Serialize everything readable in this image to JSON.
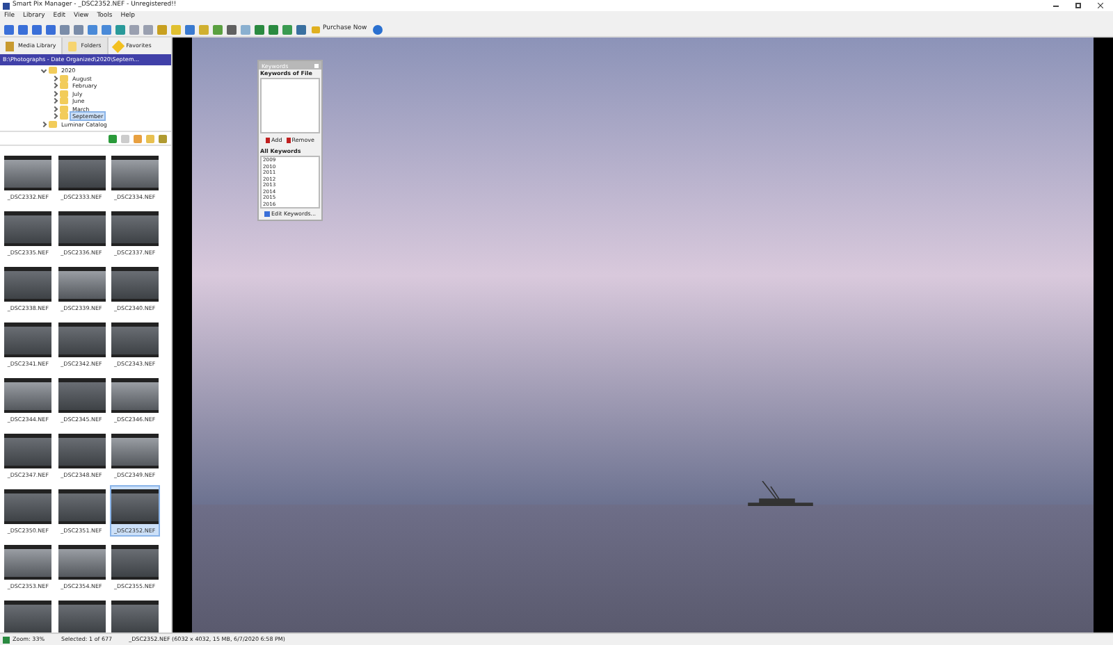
{
  "window": {
    "title": "Smart Pix Manager - _DSC2352.NEF - Unregistered!!"
  },
  "menu": [
    "File",
    "Library",
    "Edit",
    "View",
    "Tools",
    "Help"
  ],
  "toolbar": {
    "purchase_button": "Purchase Now"
  },
  "tabs": [
    {
      "label": "Media Library",
      "selected": false
    },
    {
      "label": "Folders",
      "selected": true
    },
    {
      "label": "Favorites",
      "selected": false
    }
  ],
  "path_bar": "B:\\Photographs - Date Organized\\2020\\Septem...",
  "tree": [
    {
      "label": "2020",
      "expanded": true,
      "selected": false,
      "children": [
        {
          "label": "August",
          "expanded": false,
          "selected": false
        },
        {
          "label": "February",
          "expanded": false,
          "selected": false
        },
        {
          "label": "July",
          "expanded": false,
          "selected": false
        },
        {
          "label": "June",
          "expanded": false,
          "selected": false
        },
        {
          "label": "March",
          "expanded": false,
          "selected": false
        },
        {
          "label": "September",
          "expanded": false,
          "selected": true
        }
      ]
    },
    {
      "label": "Luminar Catalog",
      "expanded": false,
      "selected": false
    }
  ],
  "thumbnails": [
    {
      "name": "_DSC2332.NEF",
      "selected": false
    },
    {
      "name": "_DSC2333.NEF",
      "selected": false
    },
    {
      "name": "_DSC2334.NEF",
      "selected": false
    },
    {
      "name": "_DSC2335.NEF",
      "selected": false
    },
    {
      "name": "_DSC2336.NEF",
      "selected": false
    },
    {
      "name": "_DSC2337.NEF",
      "selected": false
    },
    {
      "name": "_DSC2338.NEF",
      "selected": false
    },
    {
      "name": "_DSC2339.NEF",
      "selected": false
    },
    {
      "name": "_DSC2340.NEF",
      "selected": false
    },
    {
      "name": "_DSC2341.NEF",
      "selected": false
    },
    {
      "name": "_DSC2342.NEF",
      "selected": false
    },
    {
      "name": "_DSC2343.NEF",
      "selected": false
    },
    {
      "name": "_DSC2344.NEF",
      "selected": false
    },
    {
      "name": "_DSC2345.NEF",
      "selected": false
    },
    {
      "name": "_DSC2346.NEF",
      "selected": false
    },
    {
      "name": "_DSC2347.NEF",
      "selected": false
    },
    {
      "name": "_DSC2348.NEF",
      "selected": false
    },
    {
      "name": "_DSC2349.NEF",
      "selected": false
    },
    {
      "name": "_DSC2350.NEF",
      "selected": false
    },
    {
      "name": "_DSC2351.NEF",
      "selected": false
    },
    {
      "name": "_DSC2352.NEF",
      "selected": true
    },
    {
      "name": "_DSC2353.NEF",
      "selected": false
    },
    {
      "name": "_DSC2354.NEF",
      "selected": false
    },
    {
      "name": "_DSC2355.NEF",
      "selected": false
    },
    {
      "selected": false
    },
    {
      "selected": false
    },
    {
      "selected": false
    }
  ],
  "status_bar": {
    "zoom": "Zoom: 33%",
    "selection": "Selected: 1 of 677",
    "file_info": "_DSC2352.NEF (6032 x 4032, 15 MB, 6/7/2020 6:58 PM)"
  },
  "keywords_panel": {
    "title": "Keywords",
    "file_keywords_label": "Keywords of File",
    "add_button": "Add",
    "remove_button": "Remove",
    "all_keywords_label": "All Keywords",
    "all_keywords": [
      "2009",
      "2010",
      "2011",
      "2012",
      "2013",
      "2014",
      "2015",
      "2016"
    ],
    "edit_button": "Edit Keywords..."
  }
}
